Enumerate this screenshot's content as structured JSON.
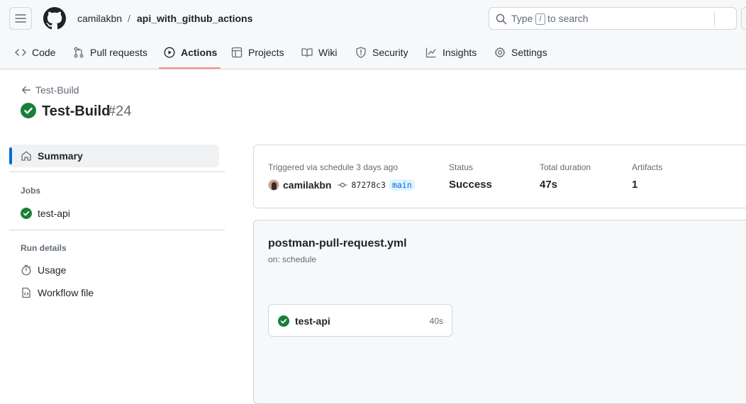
{
  "header": {
    "owner": "camilakbn",
    "separator": "/",
    "repo": "api_with_github_actions",
    "search": {
      "prefix": "Type",
      "key": "/",
      "suffix": "to search"
    }
  },
  "nav": {
    "tabs": [
      {
        "label": "Code",
        "icon": "code-icon"
      },
      {
        "label": "Pull requests",
        "icon": "pull-request-icon"
      },
      {
        "label": "Actions",
        "icon": "play-icon",
        "active": true
      },
      {
        "label": "Projects",
        "icon": "table-icon"
      },
      {
        "label": "Wiki",
        "icon": "book-icon"
      },
      {
        "label": "Security",
        "icon": "shield-icon"
      },
      {
        "label": "Insights",
        "icon": "graph-icon"
      },
      {
        "label": "Settings",
        "icon": "gear-icon"
      }
    ]
  },
  "run": {
    "back_label": "Test-Build",
    "title": "Test-Build",
    "number": "#24"
  },
  "sidebar": {
    "summary_label": "Summary",
    "jobs_heading": "Jobs",
    "jobs": [
      {
        "label": "test-api"
      }
    ],
    "run_details_heading": "Run details",
    "details": [
      {
        "label": "Usage"
      },
      {
        "label": "Workflow file"
      }
    ]
  },
  "summary": {
    "trigger_label": "Triggered via schedule 3 days ago",
    "actor": "camilakbn",
    "commit_sha": "87278c3",
    "branch": "main",
    "status_label": "Status",
    "status_value": "Success",
    "duration_label": "Total duration",
    "duration_value": "47s",
    "artifacts_label": "Artifacts",
    "artifacts_value": "1"
  },
  "workflow": {
    "file_name": "postman-pull-request.yml",
    "trigger": "on: schedule",
    "jobs": [
      {
        "name": "test-api",
        "duration": "40s"
      }
    ]
  },
  "colors": {
    "success": "#1a7f37",
    "accent": "#0969da",
    "tab_underline": "#fd8c73"
  }
}
